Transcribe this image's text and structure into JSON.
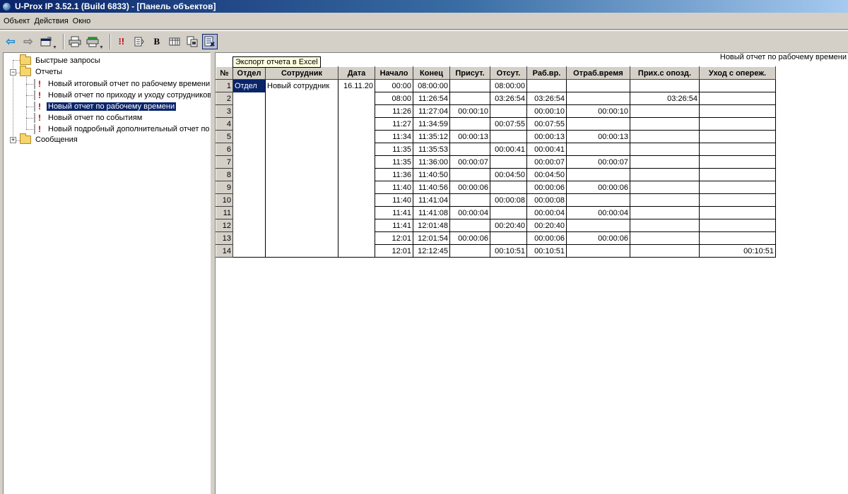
{
  "window": {
    "title": "U-Prox IP 3.52.1 (Build 6833) - [Панель объектов]"
  },
  "menu": {
    "items": [
      "Объект",
      "Действия",
      "Окно"
    ]
  },
  "tooltip": {
    "text": "Экспорт отчета в Excel"
  },
  "tree": {
    "quick_queries": "Быстрые запросы",
    "reports": "Отчеты",
    "report_items": [
      "Новый итоговый отчет по рабочему времени",
      "Новый отчет по приходу и уходу сотрудников",
      "Новый отчет по рабочему времени",
      "Новый отчет по событиям",
      "Новый подробный дополнительный отчет по"
    ],
    "messages": "Сообщения",
    "selected_index": 2
  },
  "report": {
    "title": "Новый отчет по рабочему времени",
    "columns": [
      "№",
      "Отдел",
      "Сотрудник",
      "Дата",
      "Начало",
      "Конец",
      "Присут.",
      "Отсут.",
      "Раб.вр.",
      "Отраб.время",
      "Прих.с опозд.",
      "Уход с опереж."
    ],
    "department": "Отдел",
    "employee": "Новый сотрудник",
    "date": "16.11.20",
    "rows": [
      [
        "1",
        "00:00",
        "08:00:00",
        "",
        "08:00:00",
        "",
        "",
        "",
        ""
      ],
      [
        "2",
        "08:00",
        "11:26:54",
        "",
        "03:26:54",
        "03:26:54",
        "",
        "03:26:54",
        ""
      ],
      [
        "3",
        "11:26",
        "11:27:04",
        "00:00:10",
        "",
        "00:00:10",
        "00:00:10",
        "",
        ""
      ],
      [
        "4",
        "11:27",
        "11:34:59",
        "",
        "00:07:55",
        "00:07:55",
        "",
        "",
        ""
      ],
      [
        "5",
        "11:34",
        "11:35:12",
        "00:00:13",
        "",
        "00:00:13",
        "00:00:13",
        "",
        ""
      ],
      [
        "6",
        "11:35",
        "11:35:53",
        "",
        "00:00:41",
        "00:00:41",
        "",
        "",
        ""
      ],
      [
        "7",
        "11:35",
        "11:36:00",
        "00:00:07",
        "",
        "00:00:07",
        "00:00:07",
        "",
        ""
      ],
      [
        "8",
        "11:36",
        "11:40:50",
        "",
        "00:04:50",
        "00:04:50",
        "",
        "",
        ""
      ],
      [
        "9",
        "11:40",
        "11:40:56",
        "00:00:06",
        "",
        "00:00:06",
        "00:00:06",
        "",
        ""
      ],
      [
        "10",
        "11:40",
        "11:41:04",
        "",
        "00:00:08",
        "00:00:08",
        "",
        "",
        ""
      ],
      [
        "11",
        "11:41",
        "11:41:08",
        "00:00:04",
        "",
        "00:00:04",
        "00:00:04",
        "",
        ""
      ],
      [
        "12",
        "11:41",
        "12:01:48",
        "",
        "00:20:40",
        "00:20:40",
        "",
        "",
        ""
      ],
      [
        "13",
        "12:01",
        "12:01:54",
        "00:00:06",
        "",
        "00:00:06",
        "00:00:06",
        "",
        ""
      ],
      [
        "14",
        "12:01",
        "12:12:45",
        "",
        "00:10:51",
        "00:10:51",
        "",
        "",
        "00:10:51"
      ]
    ]
  }
}
